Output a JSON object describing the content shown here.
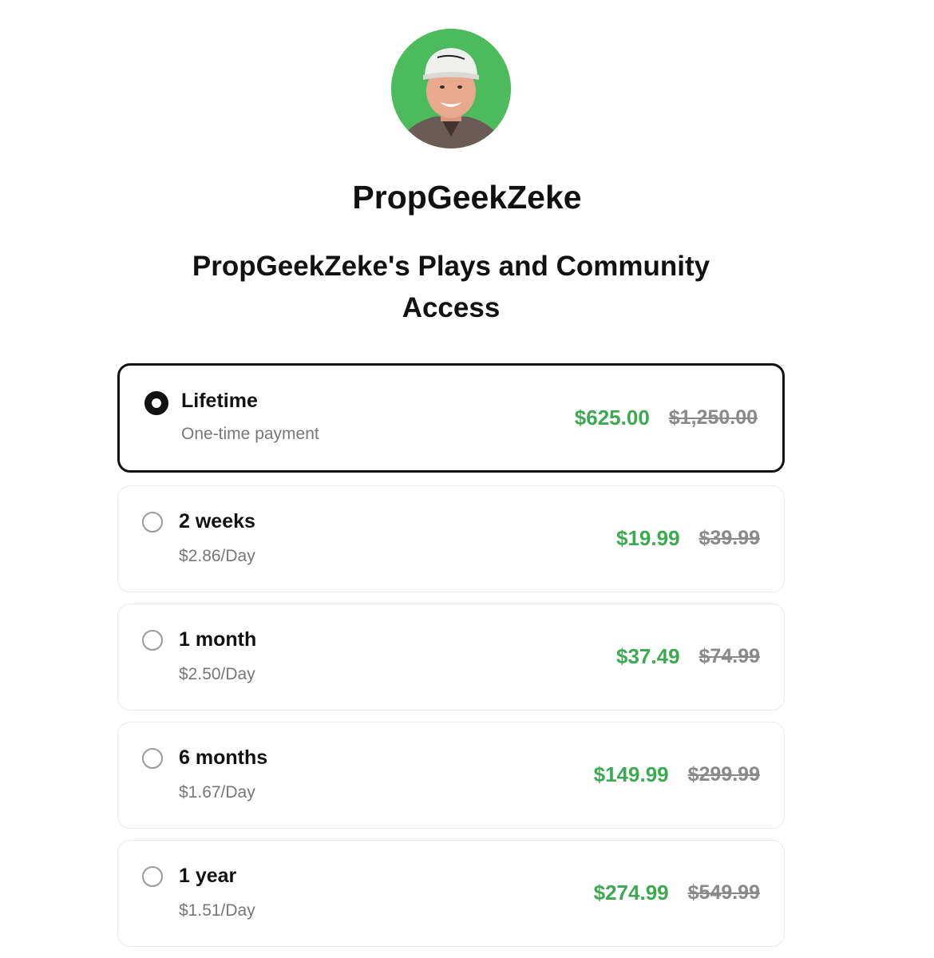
{
  "profile": {
    "avatar_background": "#4cbb5e",
    "creator_name": "PropGeekZeke"
  },
  "product": {
    "title": "PropGeekZeke's Plays and Community Access"
  },
  "colors": {
    "price_green": "#3da952",
    "selected_border": "#111111",
    "muted_text": "#777777"
  },
  "plans": [
    {
      "name": "Lifetime",
      "subtext": "One-time payment",
      "price": "$625.00",
      "original_price": "$1,250.00",
      "selected": true
    },
    {
      "name": "2 weeks",
      "subtext": "$2.86/Day",
      "price": "$19.99",
      "original_price": "$39.99",
      "selected": false
    },
    {
      "name": "1 month",
      "subtext": "$2.50/Day",
      "price": "$37.49",
      "original_price": "$74.99",
      "selected": false
    },
    {
      "name": "6 months",
      "subtext": "$1.67/Day",
      "price": "$149.99",
      "original_price": "$299.99",
      "selected": false
    },
    {
      "name": "1 year",
      "subtext": "$1.51/Day",
      "price": "$274.99",
      "original_price": "$549.99",
      "selected": false
    }
  ]
}
